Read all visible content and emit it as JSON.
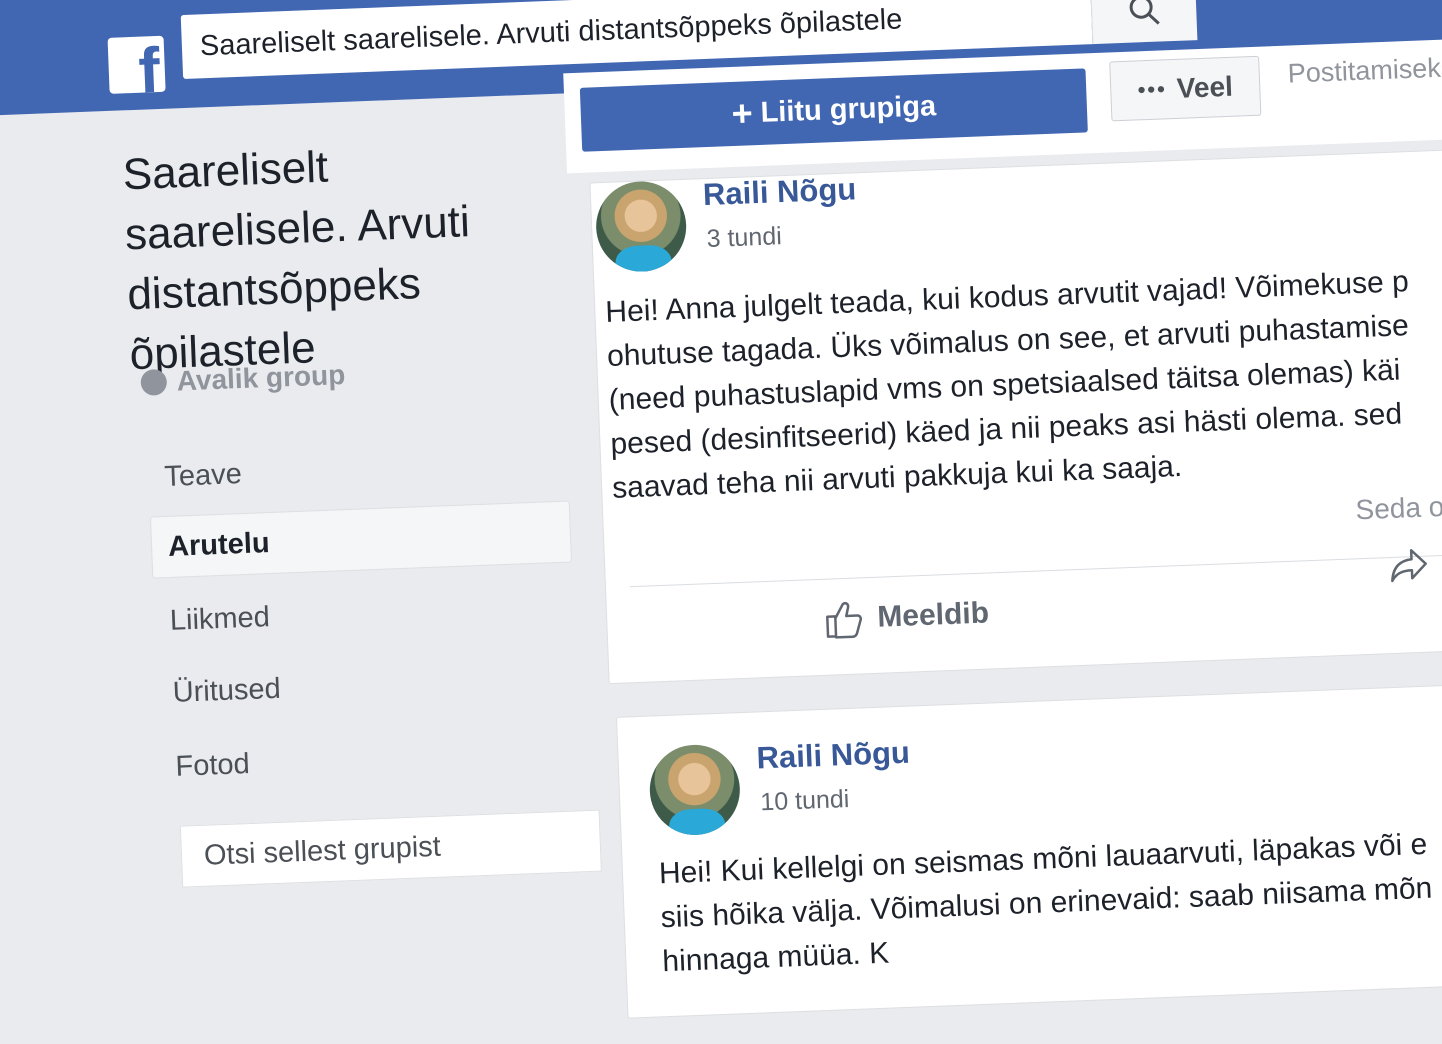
{
  "topbar": {
    "logo_letter": "f",
    "search_value": "Saareliselt saarelisele. Arvuti distantsõppeks õpilastele"
  },
  "sidebar": {
    "group_title": "Saareliselt saarelisele. Arvuti distantsõppeks õpilastele",
    "privacy": "Avalik group",
    "items": [
      {
        "label": "Teave"
      },
      {
        "label": "Arutelu",
        "active": true
      },
      {
        "label": "Liikmed"
      },
      {
        "label": "Üritused"
      },
      {
        "label": "Fotod"
      }
    ],
    "search_placeholder": "Otsi sellest grupist"
  },
  "actions": {
    "join_label": "Liitu grupiga",
    "more_label": "Veel",
    "posting_label": "Postitamiseks"
  },
  "posts": [
    {
      "author": "Raili Nõgu",
      "time": "3 tundi",
      "lines": [
        "Hei! Anna julgelt teada, kui kodus arvutit vajad! Võimekuse p",
        "ohutuse tagada. Üks võimalus on see, et arvuti puhastamise",
        "(need puhastuslapid vms on spetsiaalsed täitsa olemas) käi",
        "pesed (desinfitseerid) käed ja nii peaks asi hästi olema. sed",
        "saavad teha nii arvuti pakkuja kui ka saaja."
      ],
      "seen": "Seda on",
      "like_label": "Meeldib",
      "share_label": "Ja"
    },
    {
      "author": "Raili Nõgu",
      "time": "10 tundi",
      "lines": [
        "Hei! Kui kellelgi on seismas mõni lauaarvuti, läpakas või e",
        "siis hõika välja. Võimalusi on erinevaid: saab niisama mõn",
        "                                              hinnaga müüa. K"
      ]
    }
  ],
  "colors": {
    "brand": "#4267b2",
    "link": "#385898",
    "background": "#e9ebee"
  }
}
